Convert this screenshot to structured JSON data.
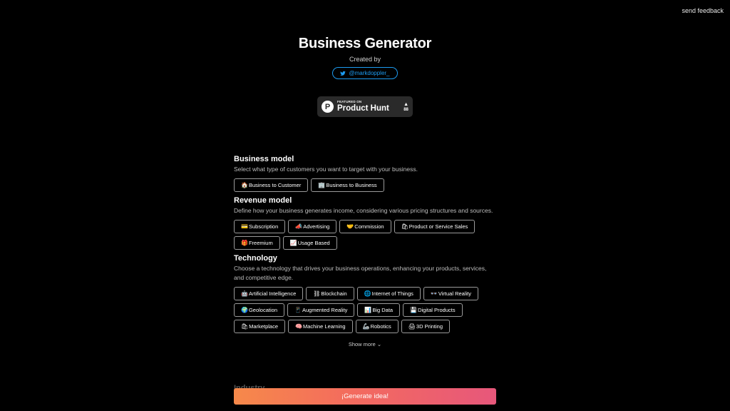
{
  "feedback_label": "send feedback",
  "header": {
    "title": "Business Generator",
    "created_by": "Created by",
    "twitter_handle": "@markdoppler_"
  },
  "product_hunt": {
    "featured": "FEATURED ON",
    "name": "Product Hunt",
    "logo_letter": "P",
    "votes": "88"
  },
  "sections": {
    "business_model": {
      "title": "Business model",
      "description": "Select what type of customers you want to target with your business.",
      "options": [
        {
          "icon": "🏠",
          "label": "Business to Customer"
        },
        {
          "icon": "🏢",
          "label": "Business to Business"
        }
      ]
    },
    "revenue_model": {
      "title": "Revenue model",
      "description": "Define how your business generates income, considering various pricing structures and sources.",
      "options": [
        {
          "icon": "💳",
          "label": "Subscription"
        },
        {
          "icon": "📣",
          "label": "Advertising"
        },
        {
          "icon": "🤝",
          "label": "Commission"
        },
        {
          "icon": "🛍",
          "label": "Product or Service Sales"
        },
        {
          "icon": "🎁",
          "label": "Freemium"
        },
        {
          "icon": "📈",
          "label": "Usage Based"
        }
      ]
    },
    "technology": {
      "title": "Technology",
      "description": "Choose a technology that drives your business operations, enhancing your products, services, and competitive edge.",
      "options": [
        {
          "icon": "🤖",
          "label": "Artificial Intelligence"
        },
        {
          "icon": "⛓",
          "label": "Blockchain"
        },
        {
          "icon": "🌐",
          "label": "Internet of Things"
        },
        {
          "icon": "👓",
          "label": "Virtual Reality"
        },
        {
          "icon": "🌍",
          "label": "Geolocation"
        },
        {
          "icon": "📱",
          "label": "Augmented Reality"
        },
        {
          "icon": "📊",
          "label": "Big Data"
        },
        {
          "icon": "💾",
          "label": "Digital Products"
        },
        {
          "icon": "🛍",
          "label": "Marketplace"
        },
        {
          "icon": "🧠",
          "label": "Machine Learning"
        },
        {
          "icon": "🦾",
          "label": "Robotics"
        },
        {
          "icon": "🖨",
          "label": "3D Printing"
        }
      ],
      "show_more": "Show more"
    },
    "industry": {
      "title": "Industry"
    }
  },
  "generate_label": "¡Generate idea!",
  "colors": {
    "background": "#000000",
    "twitter_blue": "#1d9bf0",
    "gradient_start": "#f6894a",
    "gradient_end": "#e7577b"
  }
}
